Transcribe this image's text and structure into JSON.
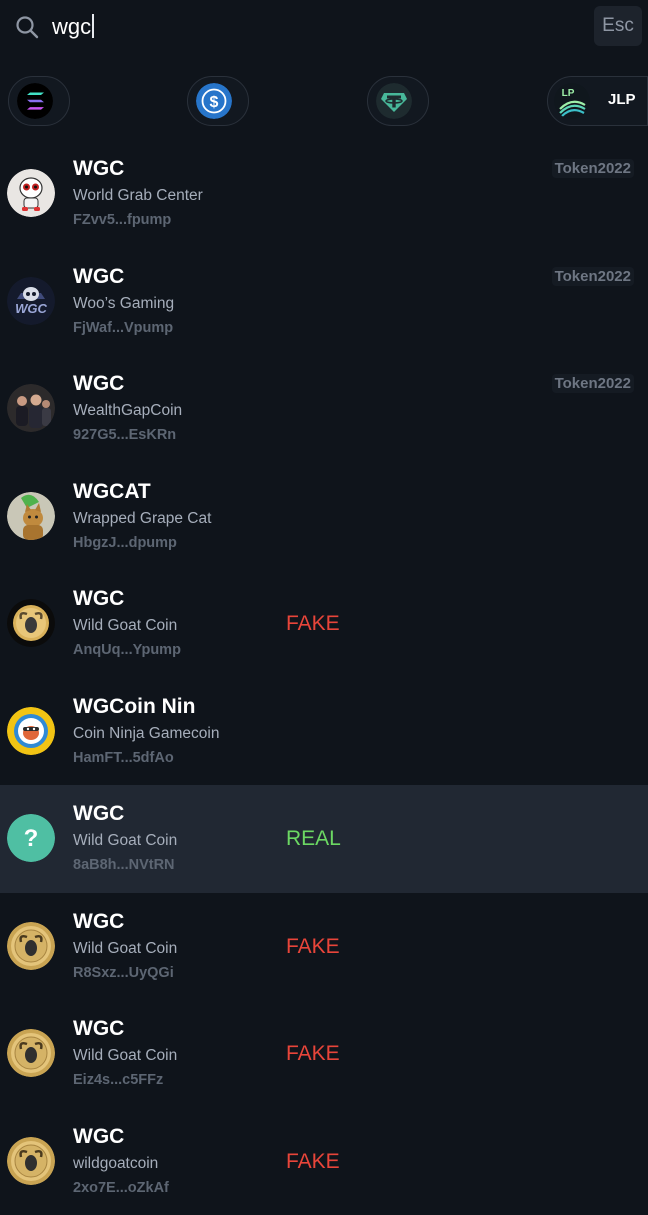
{
  "search": {
    "query": "wgc",
    "esc_label": "Esc"
  },
  "quick_tokens": [
    {
      "icon": "solana-icon",
      "label": ""
    },
    {
      "icon": "usdc-icon",
      "label": ""
    },
    {
      "icon": "usdt-icon",
      "label": ""
    },
    {
      "icon": "jlp-icon",
      "icon_text": "LP",
      "label": "JLP"
    }
  ],
  "tokens": [
    {
      "symbol": "WGC",
      "name": "World Grab Center",
      "address": "FZvv5...fpump",
      "badge": "Token2022",
      "verdict": "",
      "icon": "skull-mascot-icon"
    },
    {
      "symbol": "WGC",
      "name": "Woo’s Gaming",
      "address": "FjWaf...Vpump",
      "badge": "Token2022",
      "verdict": "",
      "icon": "gaming-skull-logo-icon"
    },
    {
      "symbol": "WGC",
      "name": "WealthGapCoin",
      "address": "927G5...EsKRn",
      "badge": "Token2022",
      "verdict": "",
      "icon": "people-photo-icon"
    },
    {
      "symbol": "WGCAT",
      "name": "Wrapped Grape Cat",
      "address": "HbgzJ...dpump",
      "badge": "",
      "verdict": "",
      "icon": "cat-photo-icon"
    },
    {
      "symbol": "WGC",
      "name": "Wild Goat Coin",
      "address": "AnqUq...Ypump",
      "badge": "",
      "verdict": "FAKE",
      "icon": "goat-coin-icon"
    },
    {
      "symbol": "WGCoin Nin",
      "name": "Coin Ninja Gamecoin",
      "address": "HamFT...5dfAo",
      "badge": "",
      "verdict": "",
      "icon": "ninja-coin-icon"
    },
    {
      "symbol": "WGC",
      "name": "Wild Goat Coin",
      "address": "8aB8h...NVtRN",
      "badge": "",
      "verdict": "REAL",
      "icon": "question-mark-icon"
    },
    {
      "symbol": "WGC",
      "name": "Wild Goat Coin",
      "address": "R8Sxz...UyQGi",
      "badge": "",
      "verdict": "FAKE",
      "icon": "goat-coin-icon"
    },
    {
      "symbol": "WGC",
      "name": "Wild Goat Coin",
      "address": "Eiz4s...c5FFz",
      "badge": "",
      "verdict": "FAKE",
      "icon": "goat-coin-icon"
    },
    {
      "symbol": "WGC",
      "name": "wildgoatcoin",
      "address": "2xo7E...oZkAf",
      "badge": "",
      "verdict": "FAKE",
      "icon": "goat-coin-icon"
    }
  ],
  "colors": {
    "background": "#0f141b",
    "selected_row": "#212833",
    "fake": "#e8453a",
    "real": "#6cd863"
  }
}
